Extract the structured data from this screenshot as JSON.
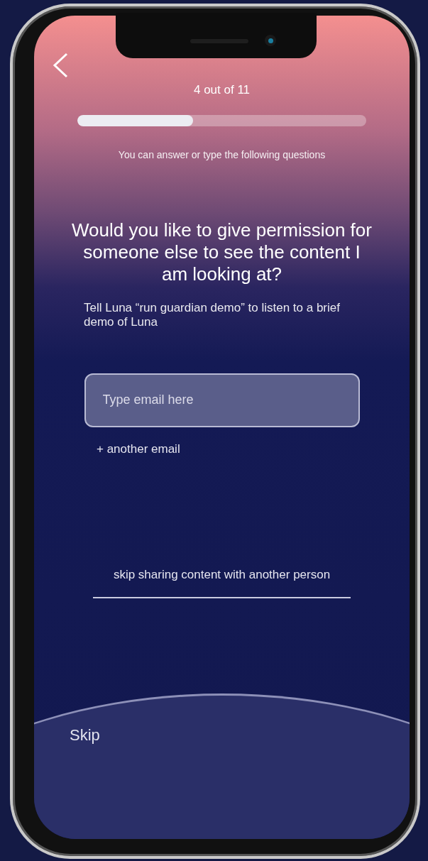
{
  "progress": {
    "label": "4 out of 11",
    "level": 0.4
  },
  "instruction": "You can answer or type the following questions",
  "question": "Would you like to give permission for someone else to see the content I am looking at?",
  "hint": "Tell Luna “run guardian demo” to listen to a brief demo of Luna",
  "email_field": {
    "placeholder": "Type email here"
  },
  "add_email_link": "+ another email",
  "skip_sharing_link": "skip sharing content with another person",
  "skip_button": "Skip"
}
